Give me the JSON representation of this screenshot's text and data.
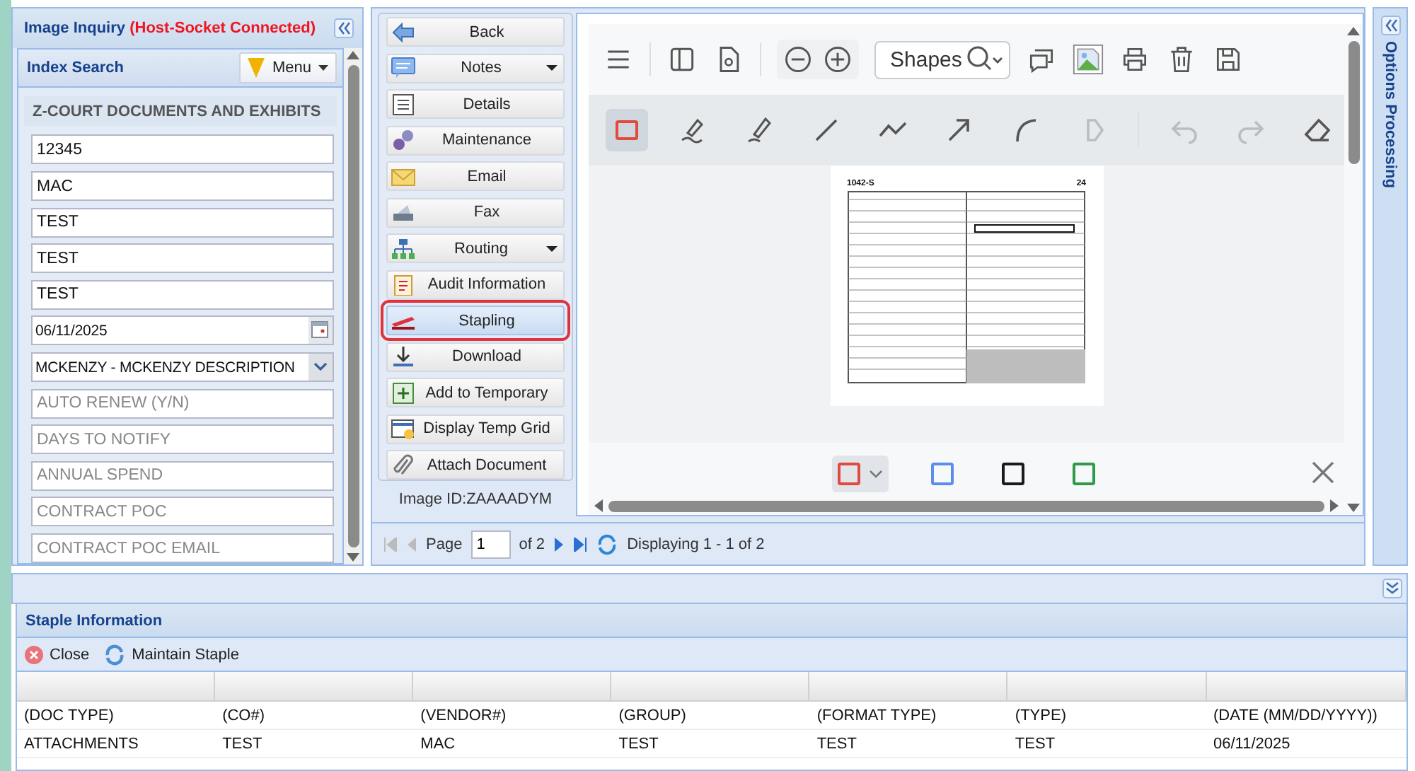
{
  "left_panel": {
    "title": "Image Inquiry",
    "status": "(Host-Socket Connected)",
    "section_title": "Index Search",
    "menu_button": "Menu",
    "group_title": "Z-COURT DOCUMENTS AND EXHIBITS",
    "fields": [
      {
        "kind": "text",
        "value": "12345"
      },
      {
        "kind": "text",
        "value": "MAC"
      },
      {
        "kind": "text",
        "value": "TEST"
      },
      {
        "kind": "text",
        "value": "TEST"
      },
      {
        "kind": "text",
        "value": "TEST"
      },
      {
        "kind": "date",
        "value": "06/11/2025"
      },
      {
        "kind": "select",
        "value": "MCKENZY - MCKENZY DESCRIPTION"
      },
      {
        "kind": "text",
        "placeholder": "AUTO RENEW (Y/N)"
      },
      {
        "kind": "text",
        "placeholder": "DAYS TO NOTIFY"
      },
      {
        "kind": "text",
        "placeholder": "ANNUAL SPEND"
      },
      {
        "kind": "text",
        "placeholder": "CONTRACT POC"
      },
      {
        "kind": "text",
        "placeholder": "CONTRACT POC EMAIL"
      }
    ]
  },
  "actions": {
    "buttons": [
      {
        "label": "Back",
        "dropdown": false,
        "selected": false
      },
      {
        "label": "Notes",
        "dropdown": true,
        "selected": false
      },
      {
        "label": "Details",
        "dropdown": false,
        "selected": false
      },
      {
        "label": "Maintenance",
        "dropdown": false,
        "selected": false
      },
      {
        "label": "Email",
        "dropdown": false,
        "selected": false
      },
      {
        "label": "Fax",
        "dropdown": false,
        "selected": false
      },
      {
        "label": "Routing",
        "dropdown": true,
        "selected": false
      },
      {
        "label": "Audit Information",
        "dropdown": false,
        "selected": false
      },
      {
        "label": "Stapling",
        "dropdown": false,
        "selected": true
      },
      {
        "label": "Download",
        "dropdown": false,
        "selected": false
      },
      {
        "label": "Add to Temporary",
        "dropdown": false,
        "selected": false
      },
      {
        "label": "Display Temp Grid",
        "dropdown": false,
        "selected": false
      },
      {
        "label": "Attach Document",
        "dropdown": false,
        "selected": false
      }
    ],
    "image_id": "Image ID:ZAAAADYM"
  },
  "pager": {
    "page_label": "Page",
    "page": "1",
    "of": "of 2",
    "display": "Displaying 1 - 1 of 2"
  },
  "viewer": {
    "search": "Shapes",
    "tools": [
      {
        "selected": true,
        "disabled": false
      },
      {
        "selected": false,
        "disabled": false
      },
      {
        "selected": false,
        "disabled": false
      },
      {
        "selected": false,
        "disabled": false
      },
      {
        "selected": false,
        "disabled": false
      },
      {
        "selected": false,
        "disabled": false
      },
      {
        "selected": false,
        "disabled": false
      },
      {
        "selected": false,
        "disabled": true
      },
      {
        "selected": false,
        "disabled": true
      },
      {
        "selected": false,
        "disabled": true
      },
      {
        "selected": false,
        "disabled": false
      }
    ],
    "page": {
      "form": "1042-S",
      "year": "24"
    },
    "colors": [
      {
        "color": "#e04a3f",
        "selected": true
      },
      {
        "color": "#5b8def",
        "selected": false
      },
      {
        "color": "#1a1a1a",
        "selected": false
      },
      {
        "color": "#2e9a4a",
        "selected": false
      }
    ]
  },
  "options_panel": {
    "title": "Options Processing"
  },
  "staple": {
    "title": "Staple Information",
    "toolbar": [
      "Close",
      "Maintain Staple"
    ],
    "rows": [
      [
        "(DOC TYPE)",
        "(CO#)",
        "(VENDOR#)",
        "(GROUP)",
        "(FORMAT TYPE)",
        "(TYPE)",
        "(DATE (MM/DD/YYYY))"
      ],
      [
        "ATTACHMENTS",
        "TEST",
        "MAC",
        "TEST",
        "TEST",
        "TEST",
        "06/11/2025"
      ]
    ]
  }
}
